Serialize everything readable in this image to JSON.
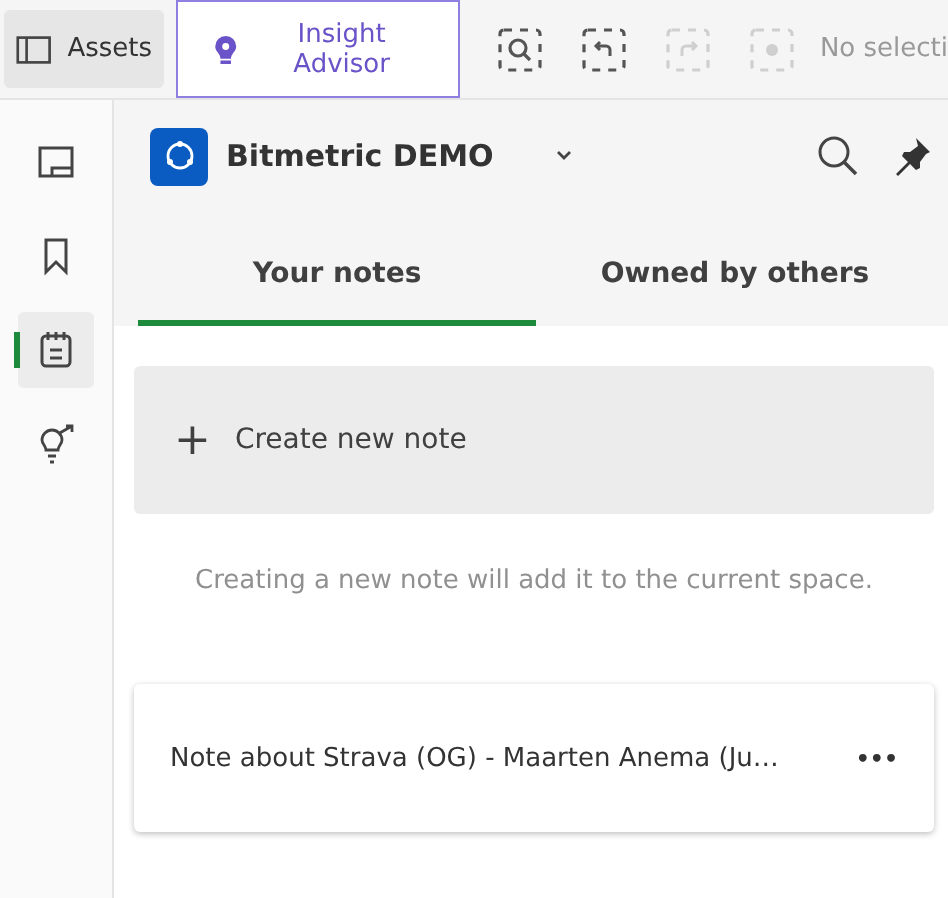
{
  "toolbar": {
    "assets_button": "Assets",
    "insight_button": {
      "label": "Insight Advisor",
      "selected": true
    },
    "tools": [
      {
        "kind": "search",
        "disabled": false
      },
      {
        "kind": "back",
        "disabled": false
      },
      {
        "kind": "forward",
        "disabled": true
      },
      {
        "kind": "clear",
        "disabled": true
      }
    ],
    "selection_text": "No selecti"
  },
  "sidebar": {
    "items": [
      {
        "kind": "sheet",
        "selected": false
      },
      {
        "kind": "bookmark",
        "selected": false
      },
      {
        "kind": "notes",
        "selected": true
      },
      {
        "kind": "insight",
        "selected": false
      }
    ]
  },
  "header": {
    "app_name": "Bitmetric DEMO"
  },
  "tabs": [
    {
      "label": "Your notes",
      "selected": true
    },
    {
      "label": "Owned by others",
      "selected": false
    }
  ],
  "create_button": {
    "icon": "+",
    "label": "Create new note"
  },
  "hint": "Creating a new note will add it to the current space.",
  "notes": [
    {
      "title": "Note about Strava (OG) - Maarten Anema (Ju…",
      "menu": "•••"
    }
  ]
}
